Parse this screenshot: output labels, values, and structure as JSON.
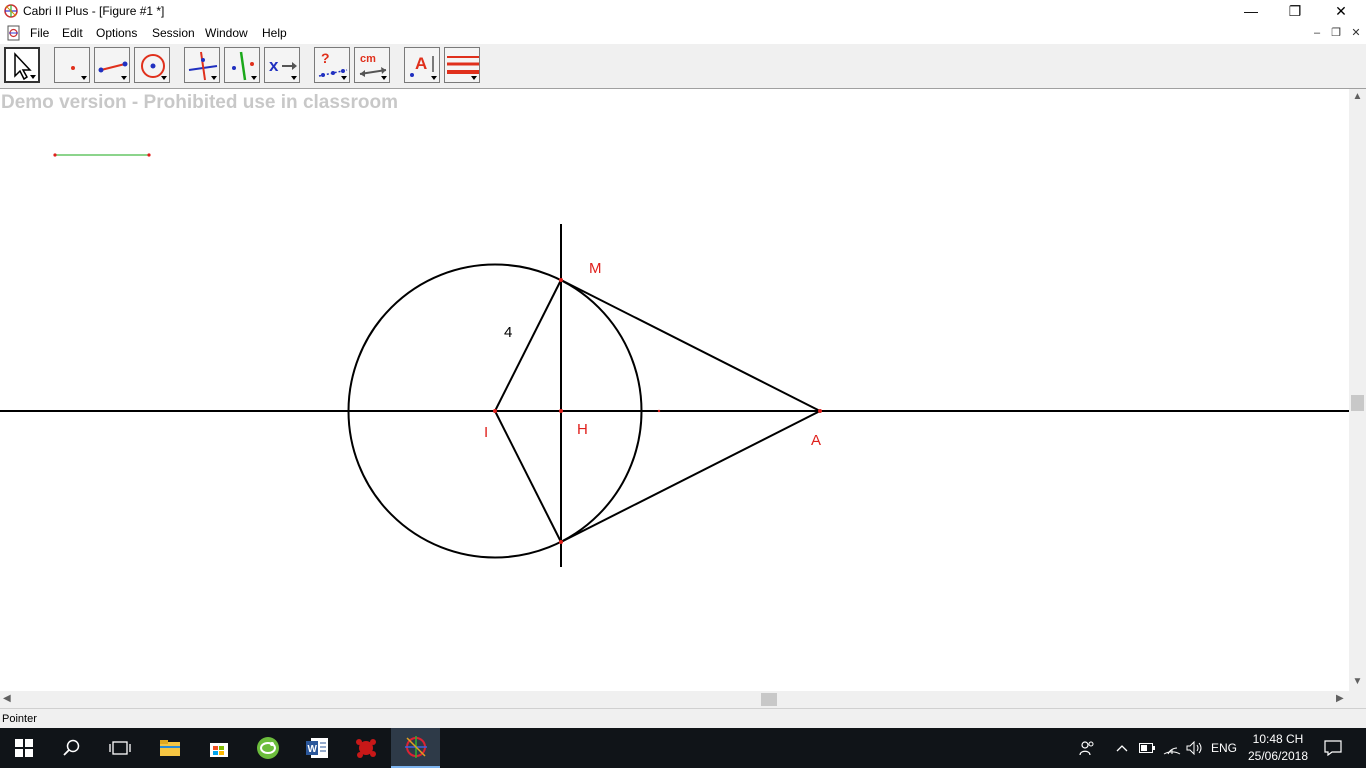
{
  "window": {
    "title": "Cabri II Plus - [Figure #1 *]",
    "minimize_glyph": "—",
    "maximize_glyph": "❐",
    "close_glyph": "✕"
  },
  "menu": [
    "File",
    "Edit",
    "Options",
    "Session",
    "Window",
    "Help"
  ],
  "mdi_controls": {
    "minimize": "–",
    "restore": "❐",
    "close": "✕"
  },
  "toolbar": {
    "tools": [
      {
        "name": "pointer-tool",
        "icon": "arrow-cursor-icon"
      },
      {
        "name": "point-tool",
        "icon": "point-icon"
      },
      {
        "name": "line-tool",
        "icon": "segment-icon"
      },
      {
        "name": "curve-tool",
        "icon": "circle-icon"
      },
      {
        "name": "construct-tool",
        "icon": "perpendicular-icon"
      },
      {
        "name": "transform-tool",
        "icon": "symmetry-icon"
      },
      {
        "name": "macro-tool",
        "icon": "macro-icon"
      },
      {
        "name": "check-property-tool",
        "icon": "check-property-icon"
      },
      {
        "name": "measure-tool",
        "icon": "measure-icon"
      },
      {
        "name": "display-tool",
        "icon": "text-label-icon"
      },
      {
        "name": "attributes-tool",
        "icon": "color-lines-icon"
      }
    ],
    "measure_label": "cm",
    "question_label": "?",
    "macro_label": "x",
    "text_label": "A"
  },
  "canvas": {
    "watermark": "Demo version - Prohibited use in classroom",
    "labels": {
      "M": "M",
      "I": "I",
      "H": "H",
      "A": "A",
      "length": "4"
    },
    "colors": {
      "label": "#e0201c",
      "construction": "#000000",
      "segment_hint": "#1aa81a"
    }
  },
  "status": "Pointer",
  "taskbar": {
    "apps": [
      "start-icon",
      "search-icon",
      "task-view-icon",
      "file-explorer-icon",
      "store-icon",
      "geogebra-icon",
      "word-icon",
      "app-red-icon",
      "cabri-icon"
    ],
    "language": "ENG",
    "time": "10:48 CH",
    "date": "25/06/2018"
  }
}
